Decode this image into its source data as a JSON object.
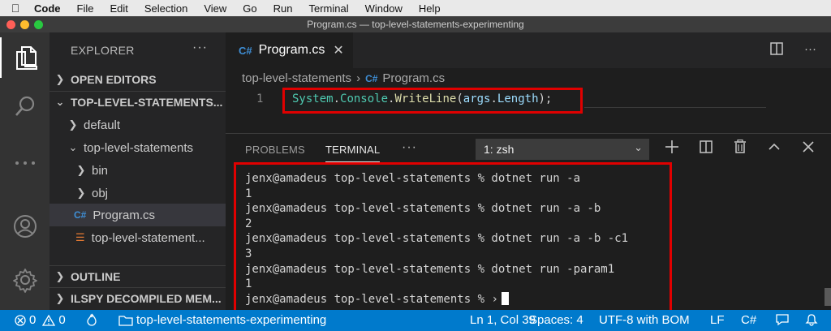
{
  "menubar": {
    "items": [
      "Code",
      "File",
      "Edit",
      "Selection",
      "View",
      "Go",
      "Run",
      "Terminal",
      "Window",
      "Help"
    ]
  },
  "window": {
    "title": "Program.cs — top-level-statements-experimenting"
  },
  "sidebar": {
    "title": "EXPLORER",
    "more": "···",
    "open_editors": "OPEN EDITORS",
    "folder": "TOP-LEVEL-STATEMENTS...",
    "tree": [
      "default",
      "top-level-statements",
      "bin",
      "obj",
      "Program.cs",
      "top-level-statement..."
    ],
    "outline": "OUTLINE",
    "ilspy": "ILSPY DECOMPILED MEM..."
  },
  "editor": {
    "tab_label": "Program.cs",
    "breadcrumb": [
      "top-level-statements",
      "Program.cs"
    ],
    "line_number": "1",
    "code_tokens": [
      "System",
      ".",
      "Console",
      ".",
      "WriteLine",
      "(",
      "args",
      ".",
      "Length",
      ");"
    ]
  },
  "panel": {
    "tabs": [
      "PROBLEMS",
      "TERMINAL"
    ],
    "more": "···",
    "shell_select": "1: zsh",
    "terminal_lines": [
      "jenx@amadeus top-level-statements % dotnet run -a",
      "1",
      "jenx@amadeus top-level-statements % dotnet run -a -b",
      "2",
      "jenx@amadeus top-level-statements % dotnet run -a -b -c1",
      "3",
      "jenx@amadeus top-level-statements % dotnet run -param1",
      "1",
      "jenx@amadeus top-level-statements % "
    ]
  },
  "statusbar": {
    "errors": "0",
    "warnings": "0",
    "folder": "top-level-statements-experimenting",
    "position": "Ln 1, Col 39",
    "spaces": "Spaces: 4",
    "encoding": "UTF-8 with BOM",
    "eol": "LF",
    "language": "C#"
  },
  "colors": {
    "statusbar": "#007acc",
    "highlight_box": "#e00000",
    "activity_bar": "#333333",
    "sidebar": "#252526",
    "editor": "#1e1e1e"
  },
  "icons": [
    "apple-icon",
    "explorer-icon",
    "search-icon",
    "ellipsis-icon",
    "account-icon",
    "settings-gear-icon",
    "csharp-file-icon",
    "rss-file-icon",
    "split-editor-icon",
    "add-icon",
    "trash-icon",
    "chevron-up-icon",
    "close-icon",
    "error-icon",
    "warning-icon",
    "flame-icon",
    "folder-icon",
    "feedback-icon",
    "bell-icon"
  ]
}
